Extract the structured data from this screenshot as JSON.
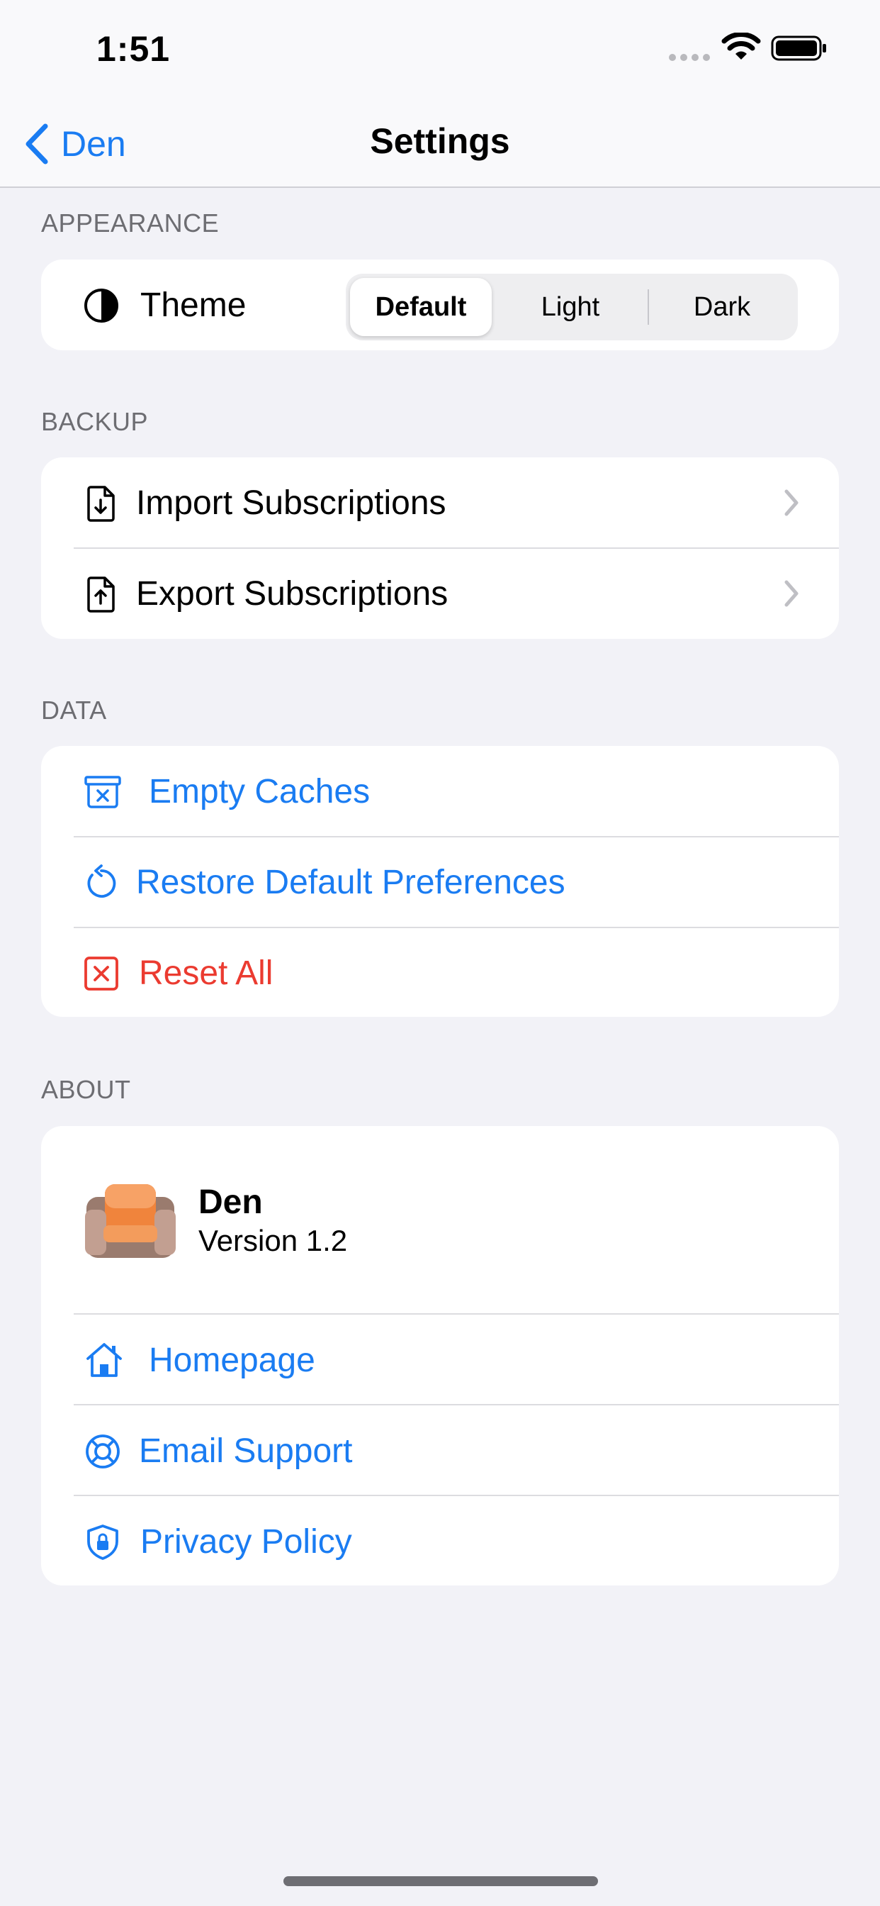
{
  "status_bar": {
    "time": "1:51"
  },
  "nav": {
    "back_label": "Den",
    "title": "Settings"
  },
  "appearance": {
    "header": "APPEARANCE",
    "theme_label": "Theme",
    "options": [
      "Default",
      "Light",
      "Dark"
    ],
    "selected": "Default"
  },
  "backup": {
    "header": "BACKUP",
    "items": [
      {
        "label": "Import Subscriptions",
        "icon": "doc-download-icon"
      },
      {
        "label": "Export Subscriptions",
        "icon": "doc-upload-icon"
      }
    ]
  },
  "data_section": {
    "header": "DATA",
    "items": [
      {
        "label": "Empty Caches",
        "icon": "archive-x-icon"
      },
      {
        "label": "Restore Default Preferences",
        "icon": "restore-arrow-icon"
      },
      {
        "label": "Reset All",
        "icon": "x-square-icon"
      }
    ]
  },
  "about": {
    "header": "ABOUT",
    "app_name": "Den",
    "version": "Version 1.2",
    "items": [
      {
        "label": "Homepage",
        "icon": "house-icon"
      },
      {
        "label": "Email Support",
        "icon": "lifebuoy-icon"
      },
      {
        "label": "Privacy Policy",
        "icon": "shield-lock-icon"
      }
    ]
  },
  "colors": {
    "accent": "#1a7cf2",
    "destructive": "#eb3b30",
    "background": "#f2f2f7"
  }
}
